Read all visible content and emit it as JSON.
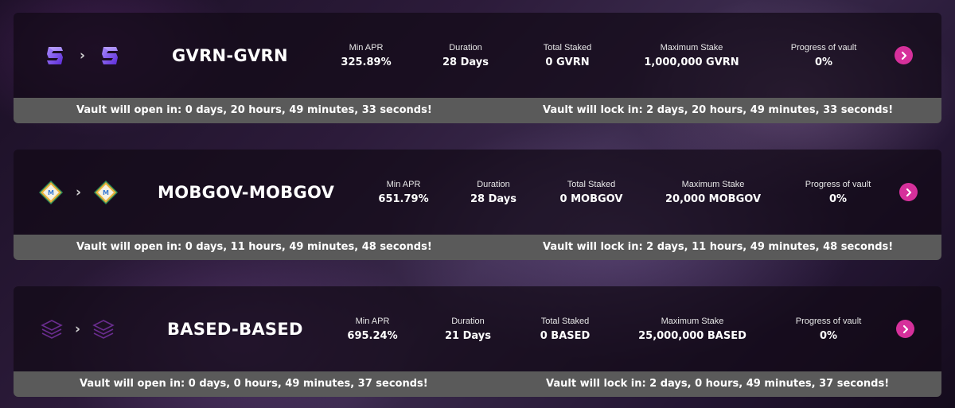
{
  "labels": {
    "min_apr": "Min APR",
    "duration": "Duration",
    "total_staked": "Total Staked",
    "maximum_stake": "Maximum Stake",
    "progress": "Progress of vault"
  },
  "colors": {
    "accent": "#d6309b",
    "timer_bar": "#5a5a5a",
    "panel": "#120a16"
  },
  "vaults": [
    {
      "title": "GVRN-GVRN",
      "icon": "gvrn-token-icon",
      "min_apr": "325.89%",
      "duration": "28 Days",
      "total_staked": "0 GVRN",
      "maximum_stake": "1,000,000 GVRN",
      "progress": "0%",
      "open_text": "Vault will open in: 0 days, 20 hours, 49 minutes, 33 seconds!",
      "lock_text": "Vault will lock in: 2 days, 20 hours, 49 minutes, 33 seconds!"
    },
    {
      "title": "MOBGOV-MOBGOV",
      "icon": "mobgov-token-icon",
      "min_apr": "651.79%",
      "duration": "28 Days",
      "total_staked": "0 MOBGOV",
      "maximum_stake": "20,000 MOBGOV",
      "progress": "0%",
      "open_text": "Vault will open in: 0 days, 11 hours, 49 minutes, 48 seconds!",
      "lock_text": "Vault will lock in: 2 days, 11 hours, 49 minutes, 48 seconds!"
    },
    {
      "title": "BASED-BASED",
      "icon": "based-token-icon",
      "min_apr": "695.24%",
      "duration": "21 Days",
      "total_staked": "0 BASED",
      "maximum_stake": "25,000,000 BASED",
      "progress": "0%",
      "open_text": "Vault will open in: 0 days, 0 hours, 49 minutes, 37 seconds!",
      "lock_text": "Vault will lock in: 2 days, 0 hours, 49 minutes, 37 seconds!"
    }
  ]
}
